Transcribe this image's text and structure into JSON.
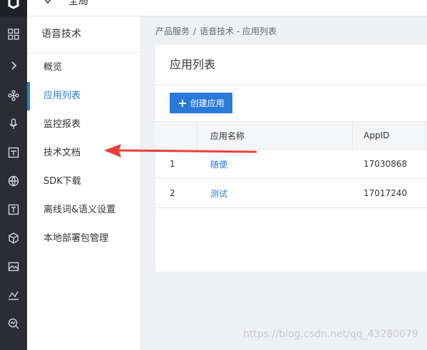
{
  "topbar": {
    "logo_icon": "cloud-logo-icon",
    "region_label": "全局",
    "region_icon": "chevron-down-icon"
  },
  "rail": {
    "items": [
      {
        "icon": "grid-icon"
      },
      {
        "icon": "chevron-right-icon"
      },
      {
        "icon": "network-icon"
      },
      {
        "icon": "microphone-icon"
      },
      {
        "icon": "image-icon"
      },
      {
        "icon": "globe-icon"
      },
      {
        "icon": "text-icon"
      },
      {
        "icon": "cube-icon"
      },
      {
        "icon": "landscape-icon"
      },
      {
        "icon": "chart-icon"
      },
      {
        "icon": "search-chart-icon"
      }
    ]
  },
  "sidebar": {
    "title": "语音技术",
    "items": [
      {
        "label": "概览",
        "active": false
      },
      {
        "label": "应用列表",
        "active": true
      },
      {
        "label": "监控报表",
        "active": false
      },
      {
        "label": "技术文档",
        "active": false
      },
      {
        "label": "SDK下载",
        "active": false
      },
      {
        "label": "离线词&语义设置",
        "active": false
      },
      {
        "label": "本地部署包管理",
        "active": false
      }
    ]
  },
  "breadcrumb": {
    "root": "产品服务",
    "separator": "/",
    "current": "语音技术 - 应用列表"
  },
  "card": {
    "title": "应用列表",
    "create_button": "创建应用",
    "create_icon": "plus-icon"
  },
  "table": {
    "headers": [
      "",
      "应用名称",
      "AppID"
    ],
    "rows": [
      {
        "index": "1",
        "name": "随便",
        "appid": "17030868"
      },
      {
        "index": "2",
        "name": "测试",
        "appid": "17017240"
      }
    ]
  },
  "annotation": {
    "arrow_color": "#e8403a",
    "points_to": "技术文档"
  },
  "watermark": "https://blog.csdn.net/qq_43280079",
  "colors": {
    "accent": "#2a7ad9",
    "rail_bg": "#2b2d33",
    "main_bg": "#eef0f4"
  }
}
